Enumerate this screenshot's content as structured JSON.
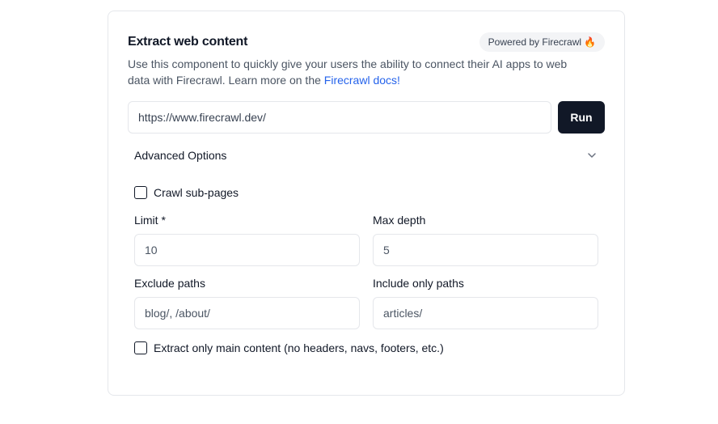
{
  "card": {
    "title": "Extract web content",
    "badge": "Powered by Firecrawl",
    "badge_icon": "🔥",
    "description_before": "Use this component to quickly give your users the ability to connect their AI apps to web data with Firecrawl. Learn more on the ",
    "description_link": "Firecrawl docs!",
    "link_color": "#2563eb"
  },
  "url_input": {
    "value": "https://www.firecrawl.dev/"
  },
  "run_button": {
    "label": "Run",
    "color": "#111827"
  },
  "advanced": {
    "label": "Advanced Options",
    "expanded": true,
    "crawl_subpages": {
      "label": "Crawl sub-pages",
      "checked": false
    },
    "limit": {
      "label": "Limit *",
      "placeholder": "10"
    },
    "max_depth": {
      "label": "Max depth",
      "placeholder": "5"
    },
    "exclude_paths": {
      "label": "Exclude paths",
      "placeholder": "blog/, /about/"
    },
    "include_paths": {
      "label": "Include only paths",
      "placeholder": "articles/"
    },
    "main_content": {
      "label": "Extract only main content (no headers, navs, footers, etc.)",
      "checked": false
    }
  }
}
